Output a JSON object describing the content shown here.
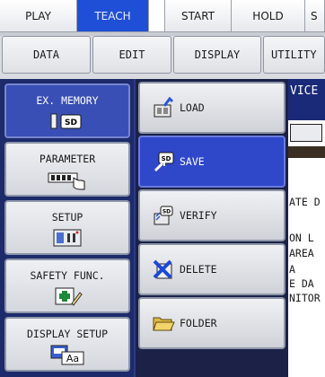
{
  "mode_tabs": [
    "PLAY",
    "TEACH",
    "START",
    "HOLD",
    "S"
  ],
  "menu_tabs": [
    "DATA",
    "EDIT",
    "DISPLAY",
    "UTILITY"
  ],
  "side_menu": [
    {
      "label": "EX. MEMORY"
    },
    {
      "label": "PARAMETER"
    },
    {
      "label": "SETUP"
    },
    {
      "label": "SAFETY FUNC."
    },
    {
      "label": "DISPLAY SETUP"
    }
  ],
  "submenu": [
    {
      "label": "LOAD"
    },
    {
      "label": "SAVE"
    },
    {
      "label": "VERIFY"
    },
    {
      "label": "DELETE"
    },
    {
      "label": "FOLDER"
    }
  ],
  "background_content": {
    "title": "VICE",
    "lines": [
      "ATE D",
      "ON L",
      "AREA",
      "A",
      "E DA",
      "NITOR"
    ]
  },
  "colors": {
    "accent": "#1f4fd6",
    "panel": "#1d2b6b",
    "selected": "#2f47c9"
  }
}
